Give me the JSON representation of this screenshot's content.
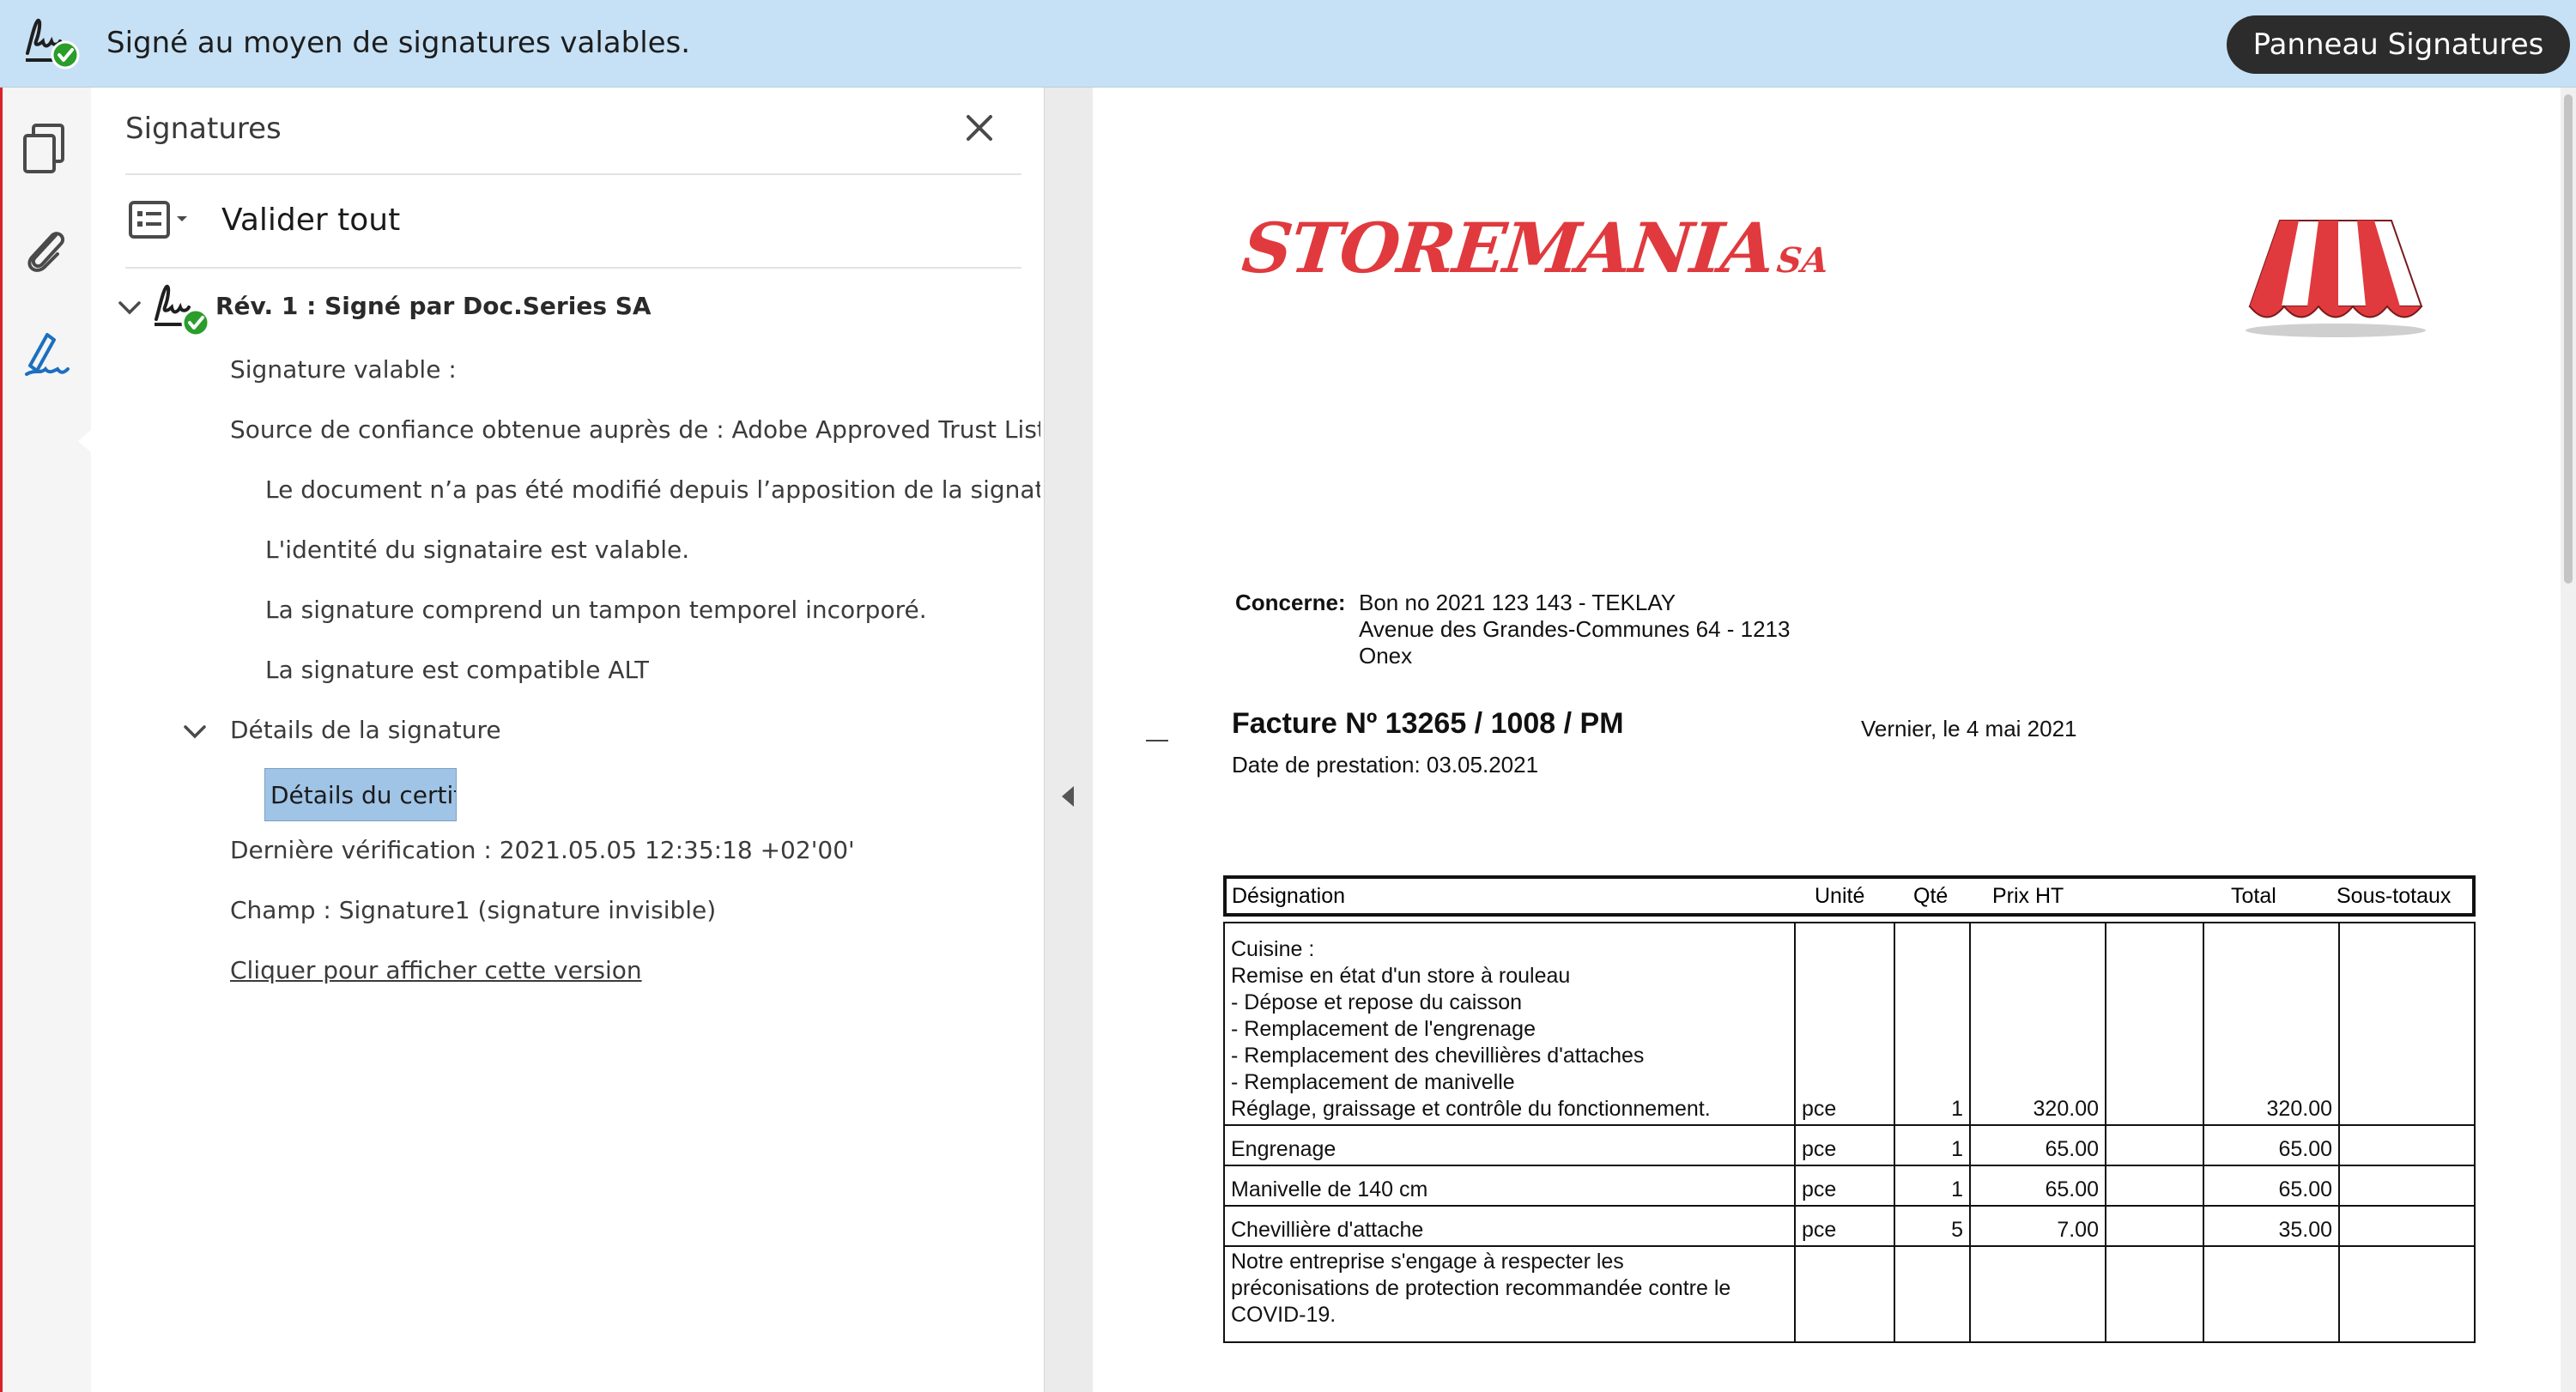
{
  "banner": {
    "status_text": "Signé au moyen de signatures valables.",
    "panel_button": "Panneau Signatures",
    "status_color": "#2a9d2a"
  },
  "rail": {
    "icons": [
      "pages-icon",
      "attachment-icon",
      "signature-pen-icon"
    ]
  },
  "signatures_panel": {
    "title": "Signatures",
    "validate_all": "Valider tout",
    "revision_title": "Rév. 1 : Signé par Doc.Series SA",
    "lines": {
      "valid": "Signature valable :",
      "trust_source": "Source de confiance obtenue auprès de : Adobe Approved Trust List (A",
      "not_modified": "Le document n’a pas été modifié depuis l’apposition de la signature",
      "identity_valid": "L'identité du signataire est valable.",
      "timestamp": "La signature comprend un tampon temporel incorporé.",
      "ltv": "La signature est compatible ALT",
      "details": "Détails de la signature",
      "certificate_details": "Détails du certificat...",
      "last_verification": "Dernière vérification : 2021.05.05 12:35:18 +02'00'",
      "field": "Champ : Signature1 (signature invisible)",
      "view_version": "Cliquer pour afficher cette version"
    }
  },
  "document": {
    "logo_main": "STOREMANIA",
    "logo_suffix": "SA",
    "concerne_label": "Concerne:",
    "concerne_lines": [
      "Bon no 2021 123 143 - TEKLAY",
      "Avenue des Grandes-Communes 64 - 1213",
      "Onex"
    ],
    "invoice_title": "Facture Nº 13265 / 1008 / PM",
    "place_date": "Vernier,  le 4 mai 2021",
    "service_date": "Date de prestation: 03.05.2021",
    "table_headers": [
      "Désignation",
      "Unité",
      "Qté",
      "Prix HT",
      "Total",
      "Sous-totaux"
    ],
    "rows": [
      {
        "designation": "Cuisine :\nRemise en état d'un store à rouleau\n- Dépose et repose du caisson\n- Remplacement de l'engrenage\n- Remplacement des chevillières d'attaches\n- Remplacement de manivelle\nRéglage, graissage et contrôle du fonctionnement.",
        "unit": "pce",
        "qty": "1",
        "price": "320.00",
        "total": "320.00",
        "subtotal": ""
      },
      {
        "designation": "Engrenage",
        "unit": "pce",
        "qty": "1",
        "price": "65.00",
        "total": "65.00",
        "subtotal": ""
      },
      {
        "designation": "Manivelle de 140 cm",
        "unit": "pce",
        "qty": "1",
        "price": "65.00",
        "total": "65.00",
        "subtotal": ""
      },
      {
        "designation": "Chevillière d'attache",
        "unit": "pce",
        "qty": "5",
        "price": "7.00",
        "total": "35.00",
        "subtotal": ""
      },
      {
        "designation": "Notre entreprise s'engage à respecter les\npréconisations de protection recommandée contre le\nCOVID-19.",
        "unit": "",
        "qty": "",
        "price": "",
        "total": "",
        "subtotal": ""
      }
    ],
    "brand_color": "#e03a3e"
  }
}
